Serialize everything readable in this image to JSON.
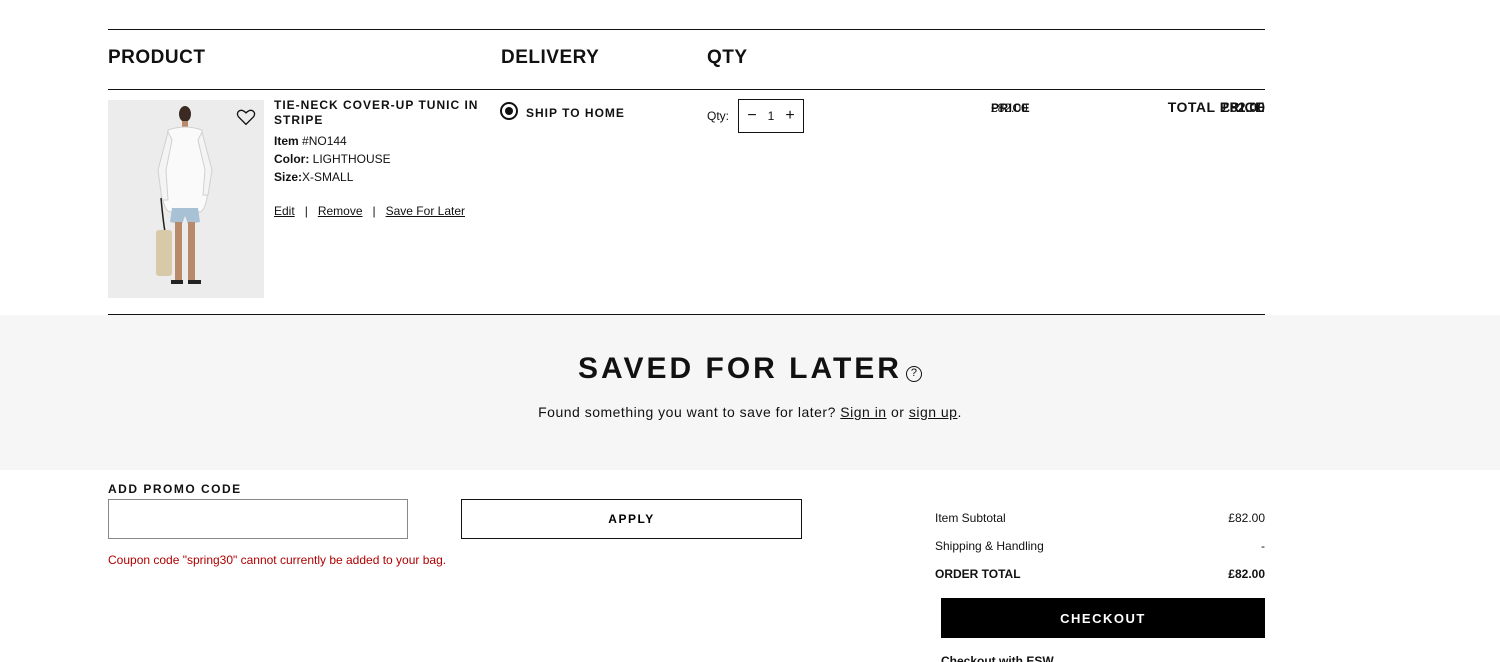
{
  "table": {
    "headers": {
      "product": "PRODUCT",
      "delivery": "DELIVERY",
      "qty": "QTY",
      "price": "PRICE",
      "total": "TOTAL PRICE"
    }
  },
  "item": {
    "name": "TIE-NECK COVER-UP TUNIC IN STRIPE",
    "item_label": "Item",
    "item_number": "#NO144",
    "color_label": "Color:",
    "color": "LIGHTHOUSE",
    "size_label": "Size:",
    "size": "X-SMALL",
    "edit_label": "Edit",
    "remove_label": "Remove",
    "save_for_later_label": "Save For Later",
    "separator": "|",
    "delivery_option": "SHIP TO HOME",
    "qty_label": "Qty:",
    "qty_value": "1",
    "qty_minus": "−",
    "qty_plus": "+",
    "price": "£82.00",
    "total": "£82.00",
    "favorite_icon": "heart-outline-icon"
  },
  "saved": {
    "title": "SAVED FOR LATER",
    "help_icon": "?",
    "text_prefix": "Found something you want to save for later?",
    "sign_in": "Sign in",
    "or": "or",
    "sign_up": "sign up",
    "suffix": "."
  },
  "promo": {
    "label": "ADD PROMO CODE",
    "value": "",
    "apply_label": "APPLY",
    "error": "Coupon code \"spring30\" cannot currently be added to your bag."
  },
  "summary": {
    "subtotal_label": "Item Subtotal",
    "subtotal_value": "£82.00",
    "shipping_label": "Shipping & Handling",
    "shipping_value": "-",
    "order_total_label": "ORDER TOTAL",
    "order_total_value": "£82.00",
    "checkout_label": "CHECKOUT",
    "esw_label": "Checkout with ESW"
  },
  "colors": {
    "error": "#b00000",
    "saved_bg": "#f6f6f6",
    "checkout_bg": "#000000"
  }
}
